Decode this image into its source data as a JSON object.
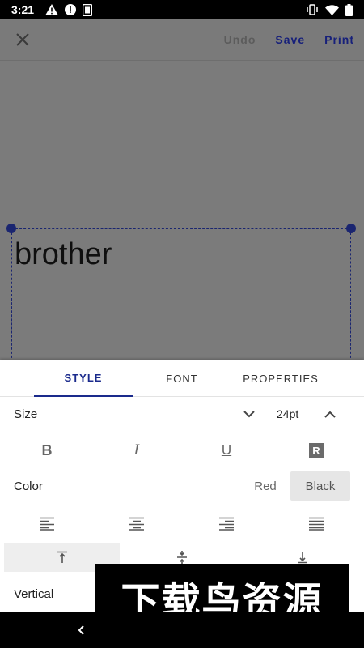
{
  "status_bar": {
    "time": "3:21",
    "left_icons": [
      "warning-icon",
      "alert-circle-icon",
      "sim-icon"
    ],
    "right_icons": [
      "vibrate-icon",
      "wifi-icon",
      "battery-icon"
    ]
  },
  "toolbar": {
    "close_icon": "close-icon",
    "undo_label": "Undo",
    "save_label": "Save",
    "print_label": "Print"
  },
  "canvas": {
    "text": "brother"
  },
  "tabs": [
    {
      "label": "STYLE",
      "active": true
    },
    {
      "label": "FONT",
      "active": false
    },
    {
      "label": "PROPERTIES",
      "active": false
    }
  ],
  "style": {
    "size_label": "Size",
    "size_value": "24pt",
    "format_buttons": {
      "bold": "B",
      "italic": "I",
      "underline": "U",
      "reverse": "R"
    },
    "color_label": "Color",
    "color_options": {
      "red": "Red",
      "black": "Black",
      "selected": "Black"
    },
    "alignment": [
      "align-left-icon",
      "align-center-icon",
      "align-right-icon",
      "align-justify-icon"
    ],
    "vertical_alignment": {
      "options": [
        "align-top-icon",
        "align-middle-icon",
        "align-bottom-icon"
      ],
      "selected": "align-top-icon"
    },
    "vertical_label": "Vertical"
  },
  "watermark": {
    "text": "下载鸟资源"
  },
  "colors": {
    "accent": "#1a2a8c",
    "selection_frame": "#1a2570",
    "dim_overlay": "#7b7b7b"
  }
}
